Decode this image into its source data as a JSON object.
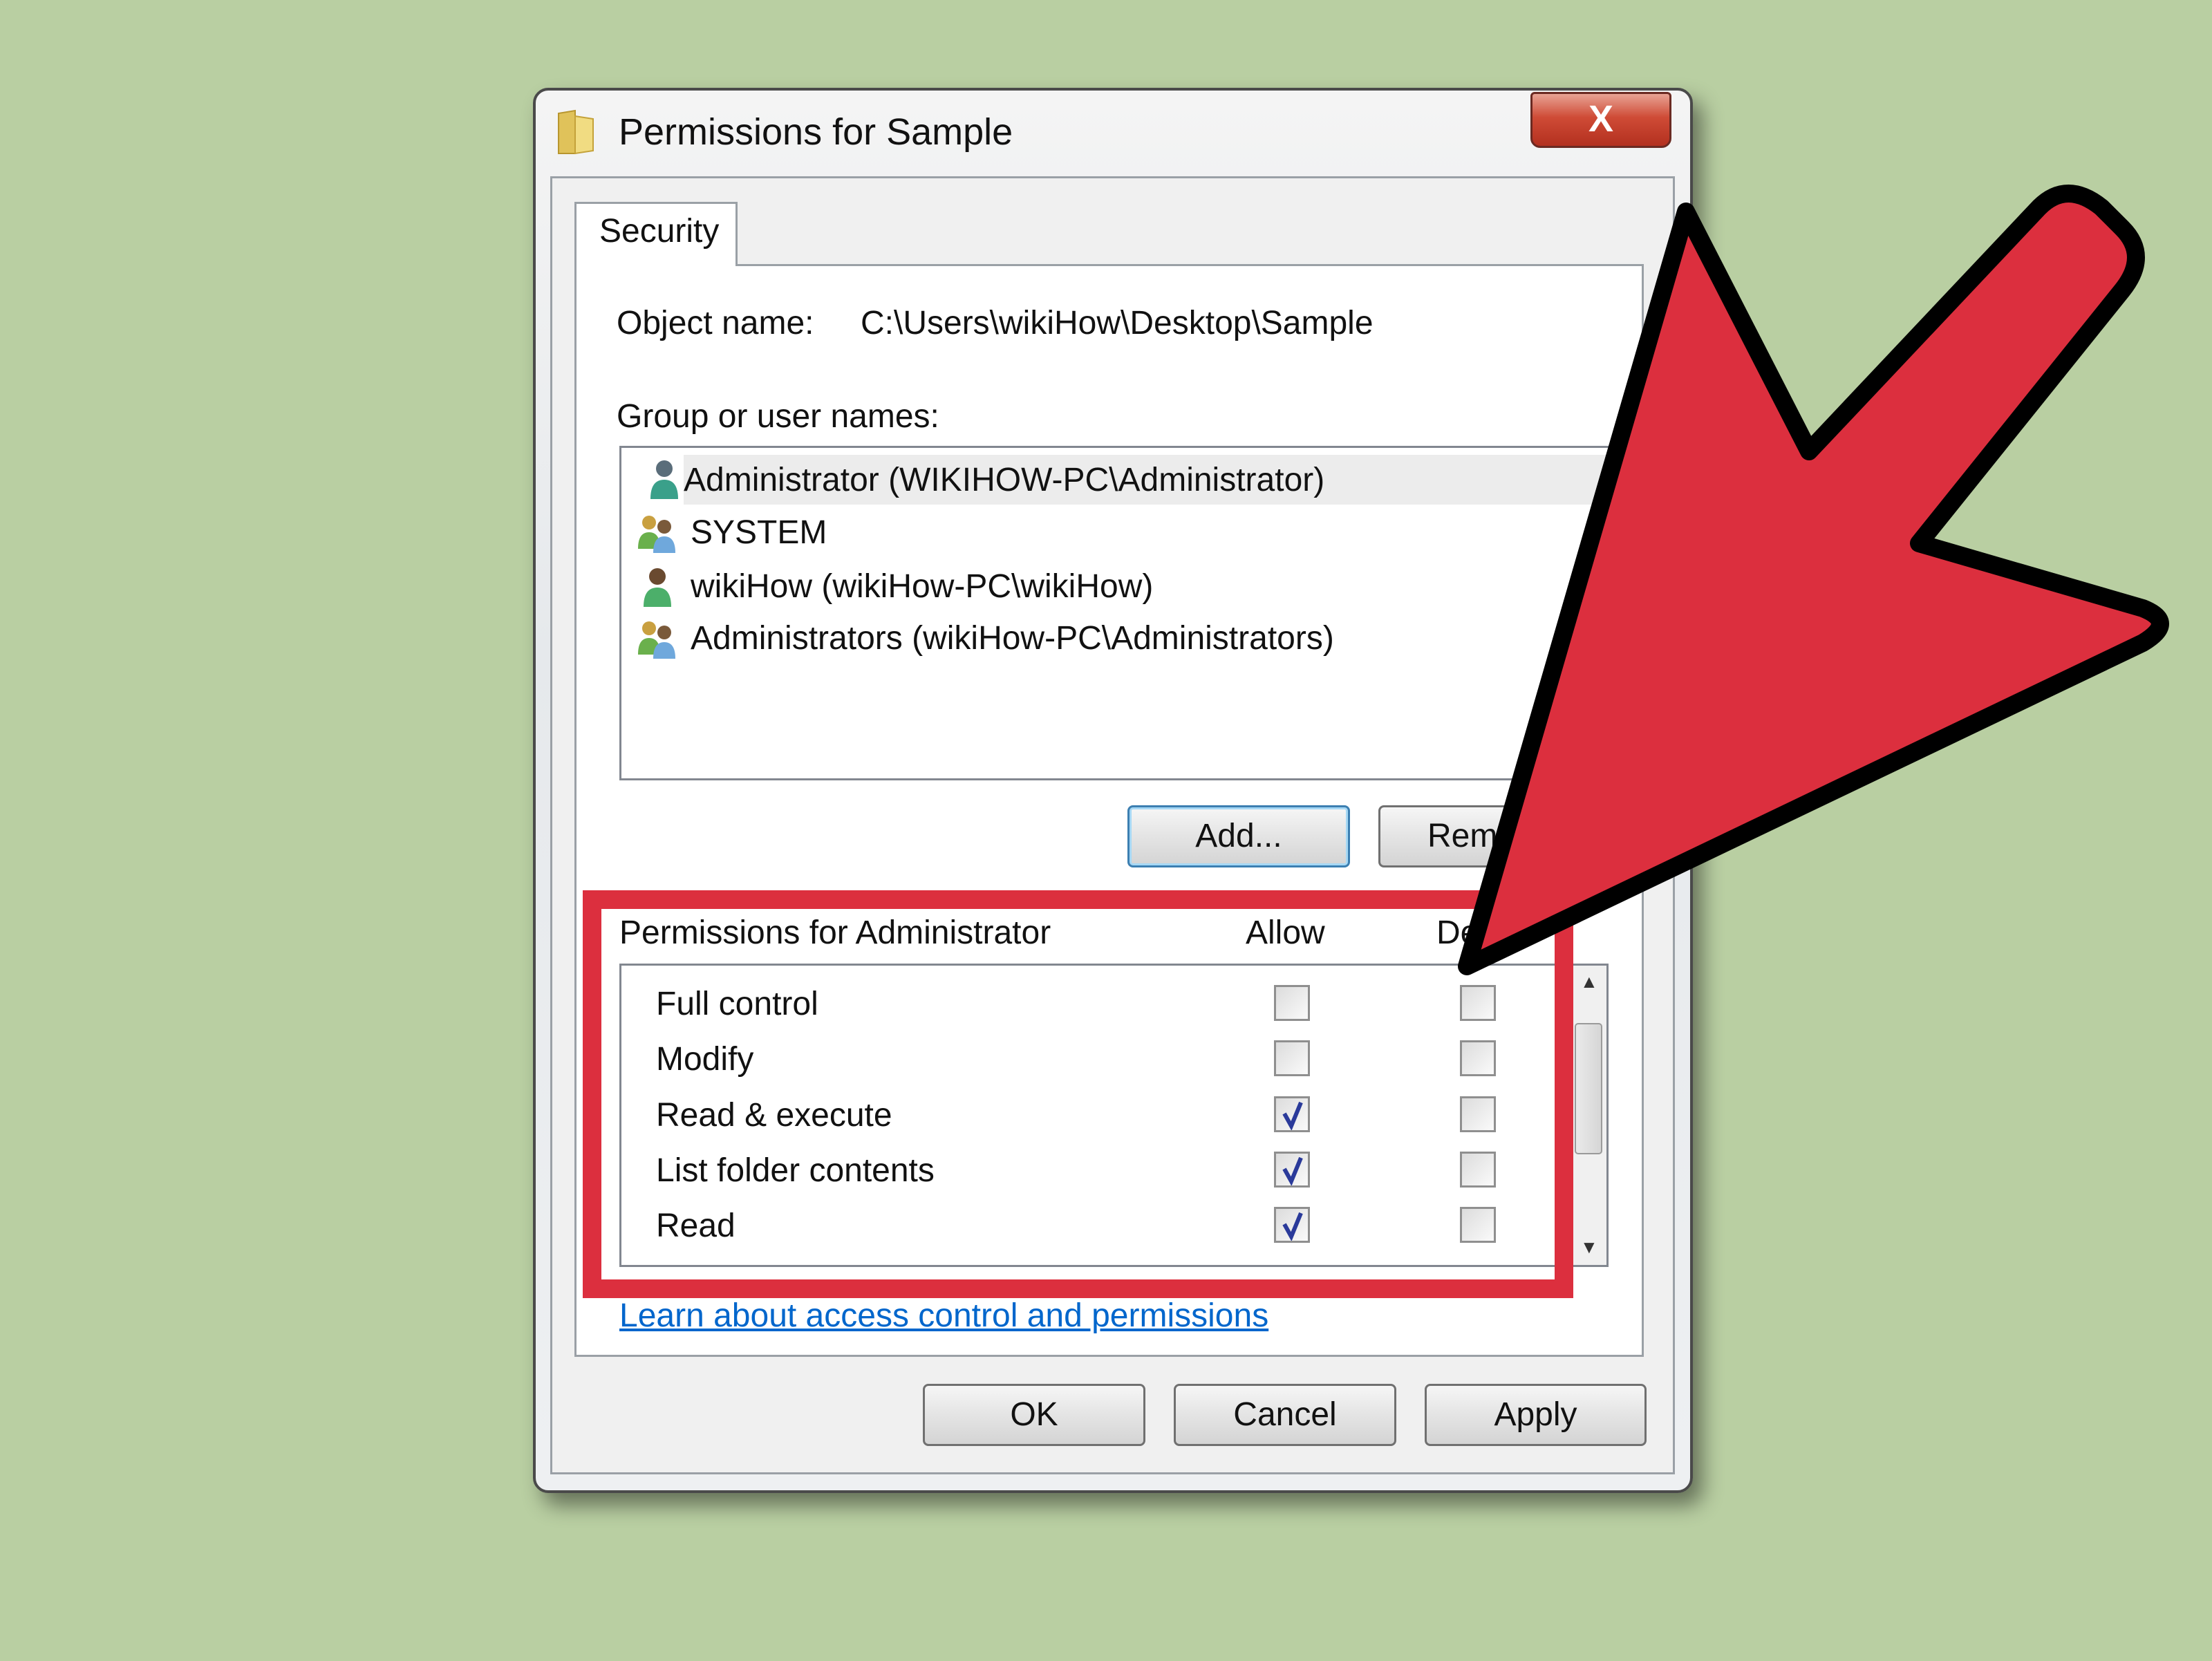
{
  "window": {
    "title": "Permissions for Sample",
    "close_label": "X",
    "title_icon": "folder-icon"
  },
  "tabs": [
    {
      "label": "Security",
      "active": true
    }
  ],
  "object": {
    "label": "Object name:",
    "value": "C:\\Users\\wikiHow\\Desktop\\Sample"
  },
  "groups": {
    "label": "Group or user names:",
    "items": [
      {
        "name": "Administrator (WIKIHOW-PC\\Administrator)",
        "icon": "user-icon",
        "selected": true
      },
      {
        "name": "SYSTEM",
        "icon": "group-icon",
        "selected": false
      },
      {
        "name": "wikiHow (wikiHow-PC\\wikiHow)",
        "icon": "user-icon",
        "selected": false
      },
      {
        "name": "Administrators (wikiHow-PC\\Administrators)",
        "icon": "group-icon",
        "selected": false
      }
    ],
    "add_label": "Add...",
    "remove_label": "Rem"
  },
  "permissions": {
    "label": "Permissions for Administrator",
    "allow_header": "Allow",
    "deny_header": "De",
    "rows": [
      {
        "name": "Full control",
        "allow": false,
        "deny": false
      },
      {
        "name": "Modify",
        "allow": false,
        "deny": false
      },
      {
        "name": "Read & execute",
        "allow": true,
        "deny": false
      },
      {
        "name": "List folder contents",
        "allow": true,
        "deny": false
      },
      {
        "name": "Read",
        "allow": true,
        "deny": false
      }
    ]
  },
  "link": "Learn about access control and permissions",
  "buttons": {
    "ok": "OK",
    "cancel": "Cancel",
    "apply": "Apply"
  },
  "colors": {
    "background": "#b9cfa2",
    "highlight_red": "#dc2f3e",
    "link": "#0066cc",
    "check": "#2a3a9a"
  }
}
